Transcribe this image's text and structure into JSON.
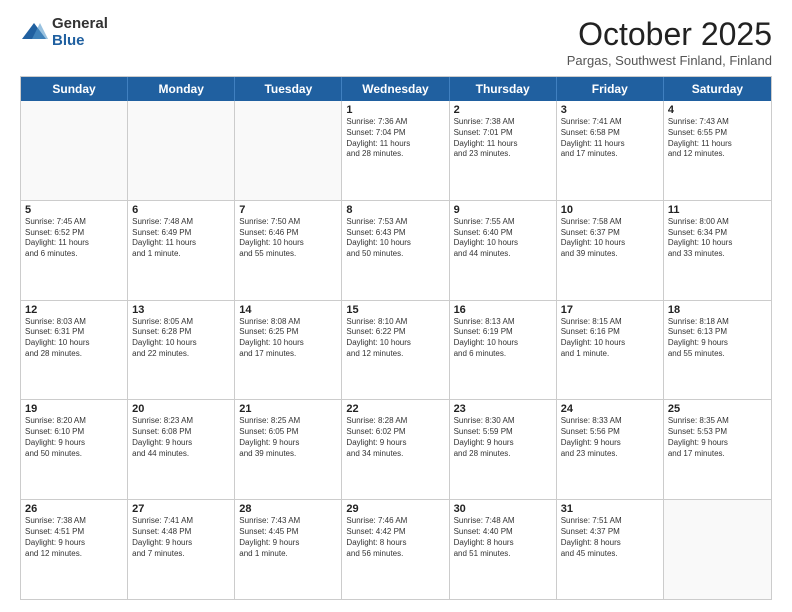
{
  "logo": {
    "general": "General",
    "blue": "Blue"
  },
  "title": "October 2025",
  "location": "Pargas, Southwest Finland, Finland",
  "days": [
    "Sunday",
    "Monday",
    "Tuesday",
    "Wednesday",
    "Thursday",
    "Friday",
    "Saturday"
  ],
  "weeks": [
    [
      {
        "day": "",
        "info": ""
      },
      {
        "day": "",
        "info": ""
      },
      {
        "day": "",
        "info": ""
      },
      {
        "day": "1",
        "info": "Sunrise: 7:36 AM\nSunset: 7:04 PM\nDaylight: 11 hours\nand 28 minutes."
      },
      {
        "day": "2",
        "info": "Sunrise: 7:38 AM\nSunset: 7:01 PM\nDaylight: 11 hours\nand 23 minutes."
      },
      {
        "day": "3",
        "info": "Sunrise: 7:41 AM\nSunset: 6:58 PM\nDaylight: 11 hours\nand 17 minutes."
      },
      {
        "day": "4",
        "info": "Sunrise: 7:43 AM\nSunset: 6:55 PM\nDaylight: 11 hours\nand 12 minutes."
      }
    ],
    [
      {
        "day": "5",
        "info": "Sunrise: 7:45 AM\nSunset: 6:52 PM\nDaylight: 11 hours\nand 6 minutes."
      },
      {
        "day": "6",
        "info": "Sunrise: 7:48 AM\nSunset: 6:49 PM\nDaylight: 11 hours\nand 1 minute."
      },
      {
        "day": "7",
        "info": "Sunrise: 7:50 AM\nSunset: 6:46 PM\nDaylight: 10 hours\nand 55 minutes."
      },
      {
        "day": "8",
        "info": "Sunrise: 7:53 AM\nSunset: 6:43 PM\nDaylight: 10 hours\nand 50 minutes."
      },
      {
        "day": "9",
        "info": "Sunrise: 7:55 AM\nSunset: 6:40 PM\nDaylight: 10 hours\nand 44 minutes."
      },
      {
        "day": "10",
        "info": "Sunrise: 7:58 AM\nSunset: 6:37 PM\nDaylight: 10 hours\nand 39 minutes."
      },
      {
        "day": "11",
        "info": "Sunrise: 8:00 AM\nSunset: 6:34 PM\nDaylight: 10 hours\nand 33 minutes."
      }
    ],
    [
      {
        "day": "12",
        "info": "Sunrise: 8:03 AM\nSunset: 6:31 PM\nDaylight: 10 hours\nand 28 minutes."
      },
      {
        "day": "13",
        "info": "Sunrise: 8:05 AM\nSunset: 6:28 PM\nDaylight: 10 hours\nand 22 minutes."
      },
      {
        "day": "14",
        "info": "Sunrise: 8:08 AM\nSunset: 6:25 PM\nDaylight: 10 hours\nand 17 minutes."
      },
      {
        "day": "15",
        "info": "Sunrise: 8:10 AM\nSunset: 6:22 PM\nDaylight: 10 hours\nand 12 minutes."
      },
      {
        "day": "16",
        "info": "Sunrise: 8:13 AM\nSunset: 6:19 PM\nDaylight: 10 hours\nand 6 minutes."
      },
      {
        "day": "17",
        "info": "Sunrise: 8:15 AM\nSunset: 6:16 PM\nDaylight: 10 hours\nand 1 minute."
      },
      {
        "day": "18",
        "info": "Sunrise: 8:18 AM\nSunset: 6:13 PM\nDaylight: 9 hours\nand 55 minutes."
      }
    ],
    [
      {
        "day": "19",
        "info": "Sunrise: 8:20 AM\nSunset: 6:10 PM\nDaylight: 9 hours\nand 50 minutes."
      },
      {
        "day": "20",
        "info": "Sunrise: 8:23 AM\nSunset: 6:08 PM\nDaylight: 9 hours\nand 44 minutes."
      },
      {
        "day": "21",
        "info": "Sunrise: 8:25 AM\nSunset: 6:05 PM\nDaylight: 9 hours\nand 39 minutes."
      },
      {
        "day": "22",
        "info": "Sunrise: 8:28 AM\nSunset: 6:02 PM\nDaylight: 9 hours\nand 34 minutes."
      },
      {
        "day": "23",
        "info": "Sunrise: 8:30 AM\nSunset: 5:59 PM\nDaylight: 9 hours\nand 28 minutes."
      },
      {
        "day": "24",
        "info": "Sunrise: 8:33 AM\nSunset: 5:56 PM\nDaylight: 9 hours\nand 23 minutes."
      },
      {
        "day": "25",
        "info": "Sunrise: 8:35 AM\nSunset: 5:53 PM\nDaylight: 9 hours\nand 17 minutes."
      }
    ],
    [
      {
        "day": "26",
        "info": "Sunrise: 7:38 AM\nSunset: 4:51 PM\nDaylight: 9 hours\nand 12 minutes."
      },
      {
        "day": "27",
        "info": "Sunrise: 7:41 AM\nSunset: 4:48 PM\nDaylight: 9 hours\nand 7 minutes."
      },
      {
        "day": "28",
        "info": "Sunrise: 7:43 AM\nSunset: 4:45 PM\nDaylight: 9 hours\nand 1 minute."
      },
      {
        "day": "29",
        "info": "Sunrise: 7:46 AM\nSunset: 4:42 PM\nDaylight: 8 hours\nand 56 minutes."
      },
      {
        "day": "30",
        "info": "Sunrise: 7:48 AM\nSunset: 4:40 PM\nDaylight: 8 hours\nand 51 minutes."
      },
      {
        "day": "31",
        "info": "Sunrise: 7:51 AM\nSunset: 4:37 PM\nDaylight: 8 hours\nand 45 minutes."
      },
      {
        "day": "",
        "info": ""
      }
    ]
  ]
}
